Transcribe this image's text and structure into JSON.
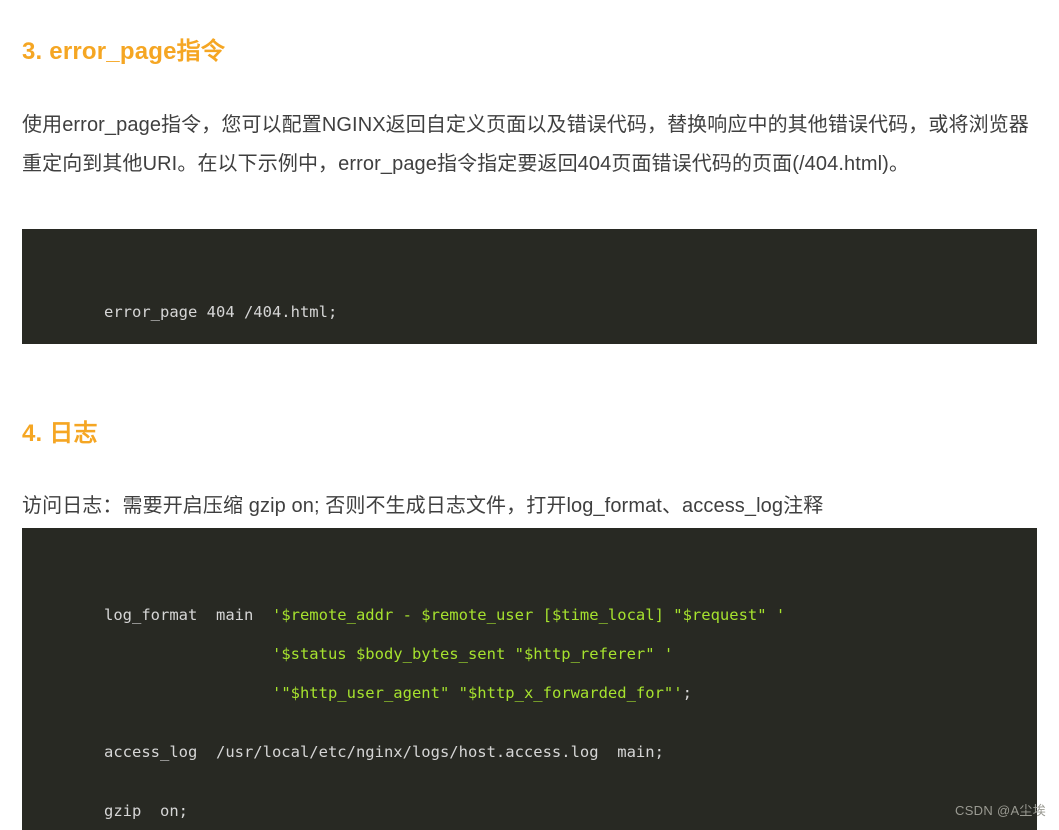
{
  "sections": [
    {
      "heading": "3. error_page指令",
      "paragraph": "使用error_page指令，您可以配置NGINX返回自定义页面以及错误代码，替换响应中的其他错误代码，或将浏览器重定向到其他URI。在以下示例中，error_page指令指定要返回404页面错误代码的页面(/404.html)。",
      "code": {
        "lines": [
          {
            "text": "error_page 404 /404.html;",
            "type": "plain"
          }
        ]
      }
    },
    {
      "heading": "4. 日志",
      "paragraph": "访问日志：需要开启压缩 gzip on; 否则不生成日志文件，打开log_format、access_log注释",
      "code": {
        "lines": [
          {
            "prefix": "log_format  main  ",
            "string": "'$remote_addr - $remote_user [$time_local] \"$request\" '",
            "suffix": "",
            "type": "mixed"
          },
          {
            "prefix": "                  ",
            "string": "'$status $body_bytes_sent \"$http_referer\" '",
            "suffix": "",
            "type": "mixed"
          },
          {
            "prefix": "                  ",
            "string": "'\"$http_user_agent\" \"$http_x_forwarded_for\"'",
            "suffix": ";",
            "type": "mixed"
          },
          {
            "text": "",
            "type": "blank"
          },
          {
            "text": "access_log  /usr/local/etc/nginx/logs/host.access.log  main;",
            "type": "plain"
          },
          {
            "text": "",
            "type": "blank"
          },
          {
            "text": "gzip  on;",
            "type": "plain"
          }
        ]
      }
    }
  ],
  "watermark": "CSDN @A尘埃",
  "colors": {
    "heading_orange": "#f5a623",
    "body_text": "#3f3f3f",
    "code_background": "#282923",
    "code_plain": "#d6d6d6",
    "code_string": "#a6e22e",
    "page_background": "#ffffff"
  }
}
